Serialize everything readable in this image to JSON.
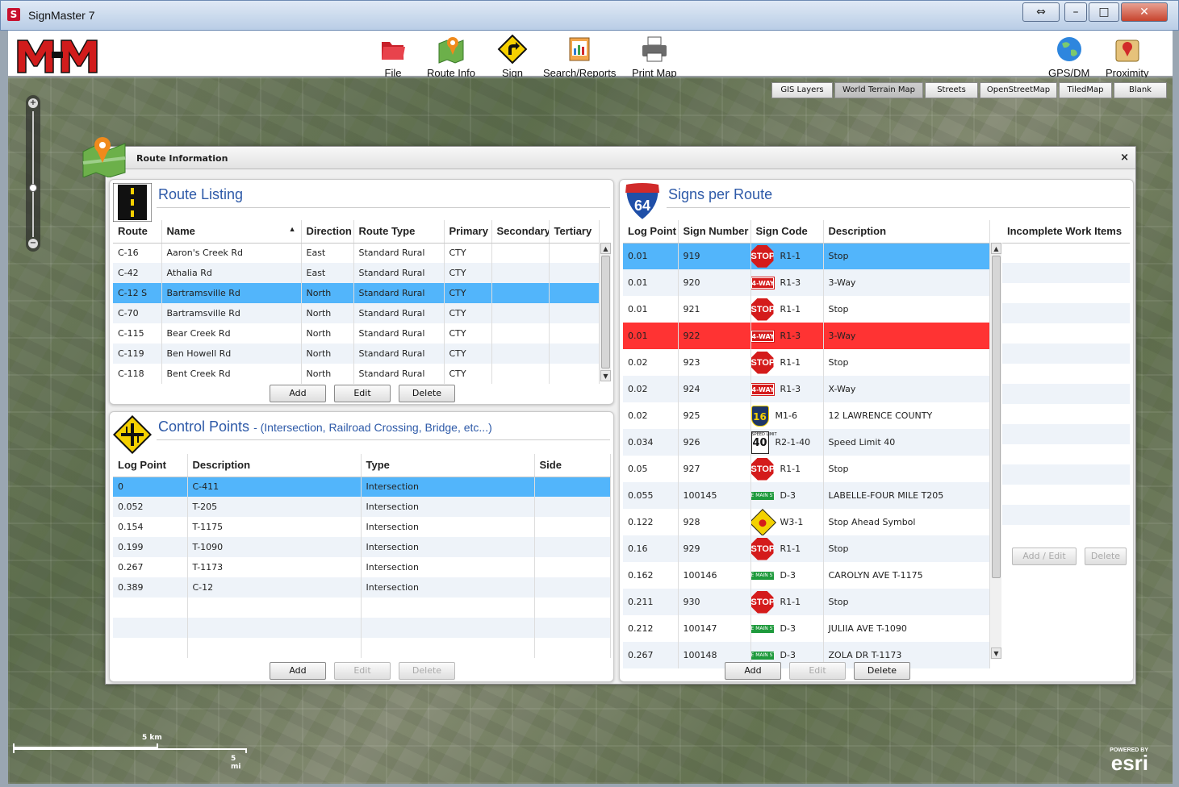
{
  "window": {
    "title": "SignMaster 7"
  },
  "toolbar": {
    "file": "File",
    "route_info": "Route Info",
    "sign": "Sign",
    "search_reports": "Search/Reports",
    "print_map": "Print Map",
    "gps_dm": "GPS/DM",
    "proximity": "Proximity"
  },
  "map_layers": [
    "GIS Layers",
    "World Terrain Map",
    "Streets",
    "OpenStreetMap",
    "TiledMap",
    "Blank"
  ],
  "map": {
    "scale_km": "5 km",
    "scale_mi": "5 mi",
    "powered_by": "POWERED BY",
    "esri": "esri"
  },
  "dialog": {
    "title": "Route Information",
    "close": "×"
  },
  "route_listing": {
    "title": "Route Listing",
    "columns": [
      "Route",
      "Name",
      "Direction",
      "Route Type",
      "Primary",
      "Secondary",
      "Tertiary"
    ],
    "sort_indicator": "▲",
    "rows": [
      [
        "C-16",
        "Aaron's Creek Rd",
        "East",
        "Standard Rural",
        "CTY",
        "",
        ""
      ],
      [
        "C-42",
        "Athalia Rd",
        "East",
        "Standard Rural",
        "CTY",
        "",
        ""
      ],
      [
        "C-12 S",
        "Bartramsville Rd",
        "North",
        "Standard Rural",
        "CTY",
        "",
        ""
      ],
      [
        "C-70",
        "Bartramsville Rd",
        "North",
        "Standard Rural",
        "CTY",
        "",
        ""
      ],
      [
        "C-115",
        "Bear Creek Rd",
        "North",
        "Standard Rural",
        "CTY",
        "",
        ""
      ],
      [
        "C-119",
        "Ben Howell Rd",
        "North",
        "Standard Rural",
        "CTY",
        "",
        ""
      ],
      [
        "C-118",
        "Bent Creek Rd",
        "North",
        "Standard Rural",
        "CTY",
        "",
        ""
      ]
    ],
    "selected_index": 2,
    "buttons": {
      "add": "Add",
      "edit": "Edit",
      "delete": "Delete"
    }
  },
  "control_points": {
    "title": "Control Points",
    "subtitle": "- (Intersection, Railroad Crossing, Bridge, etc...)",
    "columns": [
      "Log Point",
      "Description",
      "Type",
      "Side"
    ],
    "rows": [
      [
        "0",
        "C-411",
        "Intersection",
        ""
      ],
      [
        "0.052",
        "T-205",
        "Intersection",
        ""
      ],
      [
        "0.154",
        "T-1175",
        "Intersection",
        ""
      ],
      [
        "0.199",
        "T-1090",
        "Intersection",
        ""
      ],
      [
        "0.267",
        "T-1173",
        "Intersection",
        ""
      ],
      [
        "0.389",
        "C-12",
        "Intersection",
        ""
      ]
    ],
    "selected_index": 0,
    "buttons": {
      "add": "Add",
      "edit": "Edit",
      "delete": "Delete"
    }
  },
  "signs_per_route": {
    "title": "Signs per Route",
    "shield_number": "64",
    "columns": [
      "Log Point",
      "Sign Number",
      "Sign Code",
      "Description"
    ],
    "rows": [
      {
        "log": "0.01",
        "num": "919",
        "icon": "stop",
        "code": "R1-1",
        "desc": "Stop",
        "state": "sel"
      },
      {
        "log": "0.01",
        "num": "920",
        "icon": "4way",
        "code": "R1-3",
        "desc": "3-Way",
        "state": ""
      },
      {
        "log": "0.01",
        "num": "921",
        "icon": "stop",
        "code": "R1-1",
        "desc": "Stop",
        "state": ""
      },
      {
        "log": "0.01",
        "num": "922",
        "icon": "4way",
        "code": "R1-3",
        "desc": "3-Way",
        "state": "red"
      },
      {
        "log": "0.02",
        "num": "923",
        "icon": "stop",
        "code": "R1-1",
        "desc": "Stop",
        "state": ""
      },
      {
        "log": "0.02",
        "num": "924",
        "icon": "4way",
        "code": "R1-3",
        "desc": "X-Way",
        "state": ""
      },
      {
        "log": "0.02",
        "num": "925",
        "icon": "county",
        "code": "M1-6",
        "desc": "12 LAWRENCE COUNTY",
        "state": ""
      },
      {
        "log": "0.034",
        "num": "926",
        "icon": "speed",
        "code": "R2-1-40",
        "desc": "Speed Limit 40",
        "state": ""
      },
      {
        "log": "0.05",
        "num": "927",
        "icon": "stop",
        "code": "R1-1",
        "desc": "Stop",
        "state": ""
      },
      {
        "log": "0.055",
        "num": "100145",
        "icon": "street",
        "code": "D-3",
        "desc": "LABELLE-FOUR MILE T205",
        "state": ""
      },
      {
        "log": "0.122",
        "num": "928",
        "icon": "warn",
        "code": "W3-1",
        "desc": "Stop Ahead Symbol",
        "state": ""
      },
      {
        "log": "0.16",
        "num": "929",
        "icon": "stop",
        "code": "R1-1",
        "desc": "Stop",
        "state": ""
      },
      {
        "log": "0.162",
        "num": "100146",
        "icon": "street",
        "code": "D-3",
        "desc": "CAROLYN AVE T-1175",
        "state": ""
      },
      {
        "log": "0.211",
        "num": "930",
        "icon": "stop",
        "code": "R1-1",
        "desc": "Stop",
        "state": ""
      },
      {
        "log": "0.212",
        "num": "100147",
        "icon": "street",
        "code": "D-3",
        "desc": "JULIIA AVE T-1090",
        "state": ""
      },
      {
        "log": "0.267",
        "num": "100148",
        "icon": "street",
        "code": "D-3",
        "desc": "ZOLA DR T-1173",
        "state": ""
      }
    ],
    "sign_text": {
      "stop": "STOP",
      "way": "4-WAY",
      "street": "E MAIN ST",
      "county": "16",
      "speed_top": "SPEED LIMIT",
      "speed_val": "40"
    },
    "buttons": {
      "add": "Add",
      "edit": "Edit",
      "delete": "Delete"
    }
  },
  "incomplete_work": {
    "title": "Incomplete Work Items",
    "buttons": {
      "add_edit": "Add / Edit",
      "delete": "Delete"
    }
  }
}
